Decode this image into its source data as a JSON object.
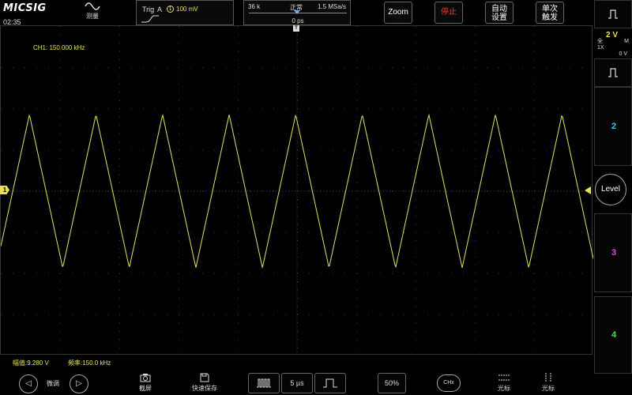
{
  "topbar": {
    "logo": "MICSIG",
    "clock": "02:35",
    "measure_label": "测量"
  },
  "trigger": {
    "label": "Trig",
    "source": "A",
    "channel": "1",
    "level": "100 mV"
  },
  "timebase": {
    "points": "36 k",
    "mode": "正常",
    "sample_rate": "1.5 MSa/s",
    "delay": "0 ps"
  },
  "buttons": {
    "zoom": "Zoom",
    "stop": "停止",
    "auto_set_line1": "自动",
    "auto_set_line2": "设置",
    "single_line1": "单次",
    "single_line2": "触发"
  },
  "waveform": {
    "freq_label": "CH1: 150.000 kHz",
    "channel_marker": "1",
    "trigger_marker": "T",
    "cycles_visible": 9,
    "shape": "triangle",
    "color": "#e8e34a"
  },
  "measurements": {
    "amplitude": "幅值:9.280 V",
    "frequency": "频率:150.0 kHz"
  },
  "right_panel": {
    "ch1_volts": "2 V",
    "ch1_coupling_top": "全",
    "ch1_coupling_bottom": "1X",
    "ch1_bw_top": "M",
    "ch1_bw_bottom": "",
    "ch1_offset": "0 V",
    "ch2": "2",
    "ch3": "3",
    "ch4": "4",
    "level": "Level",
    "ch2_color": "#3fc3ff",
    "ch3_color": "#e040e0",
    "ch4_color": "#40e040"
  },
  "bottombar": {
    "fine_tune": "微调",
    "screenshot": "截屏",
    "quick_save": "快速保存",
    "time_per_div": "5 µs",
    "percent": "50%",
    "chx": "CHx",
    "cursor1": "光标",
    "cursor2": "光标"
  }
}
